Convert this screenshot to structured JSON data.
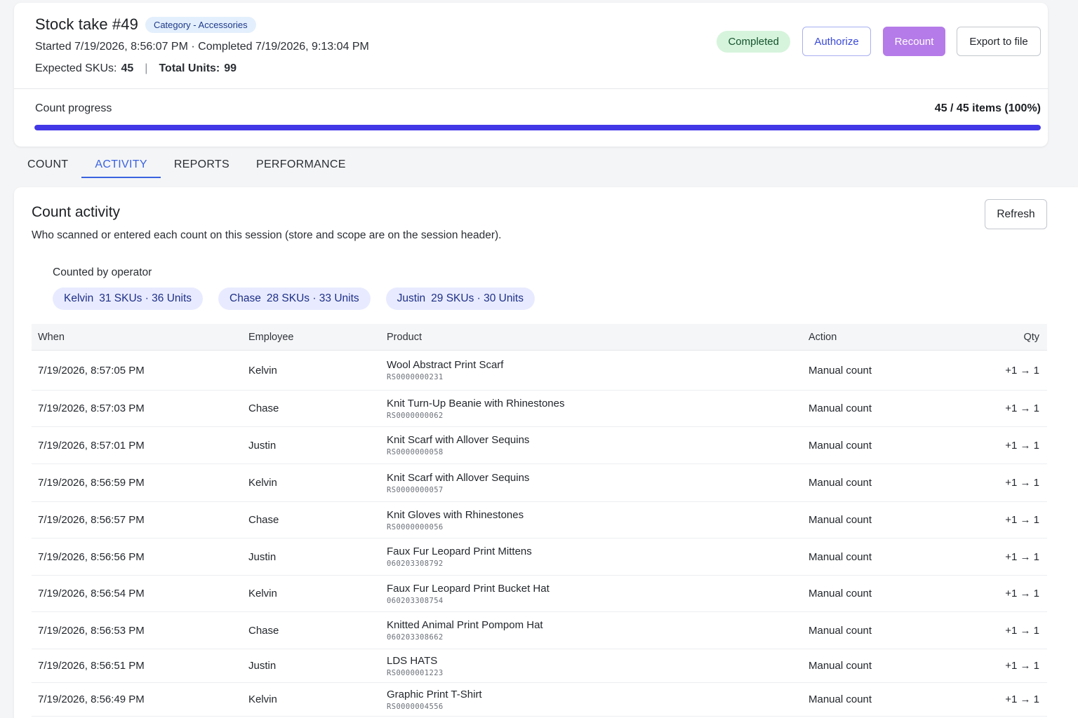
{
  "header": {
    "title": "Stock take #49",
    "category": "Category - Accessories",
    "times": "Started 7/19/2026, 8:56:07 PM · Completed 7/19/2026, 9:13:04 PM",
    "expected_skus_label": "Expected SKUs:",
    "expected_skus_value": "45",
    "total_units_label": "Total Units:",
    "total_units_value": "99",
    "status": "Completed",
    "authorize_label": "Authorize",
    "recount_label": "Recount",
    "export_label": "Export to file",
    "progress_label": "Count progress",
    "progress_value": "45 / 45 items (100%)",
    "progress_fraction": 1.0
  },
  "tabs": [
    {
      "label": "COUNT",
      "active": false
    },
    {
      "label": "ACTIVITY",
      "active": true
    },
    {
      "label": "REPORTS",
      "active": false
    },
    {
      "label": "PERFORMANCE",
      "active": false
    }
  ],
  "activity": {
    "title": "Count activity",
    "description": "Who scanned or entered each count on this session (store and scope are on the session header).",
    "refresh_label": "Refresh",
    "operators_label": "Counted by operator",
    "operators": [
      {
        "name": "Kelvin",
        "stats": "31 SKUs · 36 Units"
      },
      {
        "name": "Chase",
        "stats": "28 SKUs · 33 Units"
      },
      {
        "name": "Justin",
        "stats": "29 SKUs · 30 Units"
      }
    ],
    "columns": {
      "when": "When",
      "employee": "Employee",
      "product": "Product",
      "action": "Action",
      "qty": "Qty"
    },
    "rows": [
      {
        "when": "7/19/2026, 8:57:05 PM",
        "employee": "Kelvin",
        "product": "Wool Abstract Print Scarf",
        "sku": "RS0000000231",
        "action": "Manual count",
        "qty": "+1 → 1"
      },
      {
        "when": "7/19/2026, 8:57:03 PM",
        "employee": "Chase",
        "product": "Knit Turn-Up Beanie with Rhinestones",
        "sku": "RS0000000062",
        "action": "Manual count",
        "qty": "+1 → 1"
      },
      {
        "when": "7/19/2026, 8:57:01 PM",
        "employee": "Justin",
        "product": "Knit Scarf with Allover Sequins",
        "sku": "RS0000000058",
        "action": "Manual count",
        "qty": "+1 → 1"
      },
      {
        "when": "7/19/2026, 8:56:59 PM",
        "employee": "Kelvin",
        "product": "Knit Scarf with Allover Sequins",
        "sku": "RS0000000057",
        "action": "Manual count",
        "qty": "+1 → 1"
      },
      {
        "when": "7/19/2026, 8:56:57 PM",
        "employee": "Chase",
        "product": "Knit Gloves with Rhinestones",
        "sku": "RS0000000056",
        "action": "Manual count",
        "qty": "+1 → 1"
      },
      {
        "when": "7/19/2026, 8:56:56 PM",
        "employee": "Justin",
        "product": "Faux Fur Leopard Print Mittens",
        "sku": "060203308792",
        "action": "Manual count",
        "qty": "+1 → 1"
      },
      {
        "when": "7/19/2026, 8:56:54 PM",
        "employee": "Kelvin",
        "product": "Faux Fur Leopard Print Bucket Hat",
        "sku": "060203308754",
        "action": "Manual count",
        "qty": "+1 → 1"
      },
      {
        "when": "7/19/2026, 8:56:53 PM",
        "employee": "Chase",
        "product": "Knitted Animal Print Pompom Hat",
        "sku": "060203308662",
        "action": "Manual count",
        "qty": "+1 → 1"
      },
      {
        "when": "7/19/2026, 8:56:51 PM",
        "employee": "Justin",
        "product": "LDS HATS",
        "sku": "RS0000001223",
        "action": "Manual count",
        "qty": "+1 → 1"
      },
      {
        "when": "7/19/2026, 8:56:49 PM",
        "employee": "Kelvin",
        "product": "Graphic Print T-Shirt",
        "sku": "RS0000004556",
        "action": "Manual count",
        "qty": "+1 → 1"
      }
    ]
  }
}
